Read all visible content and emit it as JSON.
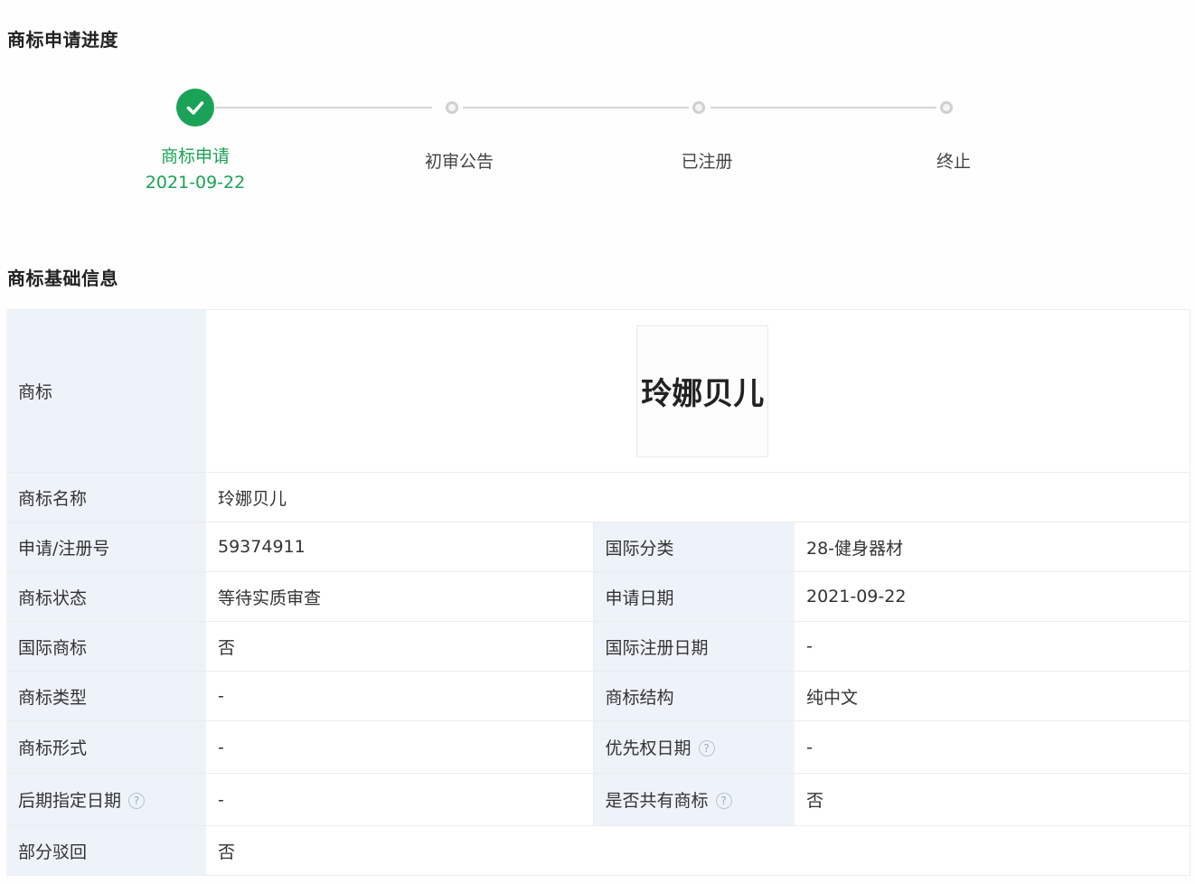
{
  "progress": {
    "title": "商标申请进度",
    "steps": [
      {
        "label": "商标申请",
        "date": "2021-09-22",
        "status": "done"
      },
      {
        "label": "初审公告",
        "date": "",
        "status": "pending"
      },
      {
        "label": "已注册",
        "date": "",
        "status": "pending"
      },
      {
        "label": "终止",
        "date": "",
        "status": "pending"
      }
    ]
  },
  "basic": {
    "title": "商标基础信息",
    "logo_label": "商标",
    "logo_text": "玲娜贝儿",
    "name_label": "商标名称",
    "name_value": "玲娜贝儿",
    "rows": [
      {
        "l1": "申请/注册号",
        "v1": "59374911",
        "l2": "国际分类",
        "v2": "28-健身器材"
      },
      {
        "l1": "商标状态",
        "v1": "等待实质审查",
        "l2": "申请日期",
        "v2": "2021-09-22"
      },
      {
        "l1": "国际商标",
        "v1": "否",
        "l2": "国际注册日期",
        "v2": "-"
      },
      {
        "l1": "商标类型",
        "v1": "-",
        "l2": "商标结构",
        "v2": "纯中文"
      },
      {
        "l1": "商标形式",
        "v1": "-",
        "l2": "优先权日期",
        "v2": "-"
      },
      {
        "l1": "后期指定日期",
        "v1": "-",
        "l2": "是否共有商标",
        "v2": "否"
      }
    ],
    "partial_label": "部分驳回",
    "partial_value": "否",
    "help_glyph": "?"
  },
  "colors": {
    "accent_green": "#1aa356",
    "label_bg": "#eef3fa",
    "line_gray": "#d4d4d4"
  },
  "icons": {
    "done_step": "check-icon",
    "help": "question-circle-icon"
  }
}
